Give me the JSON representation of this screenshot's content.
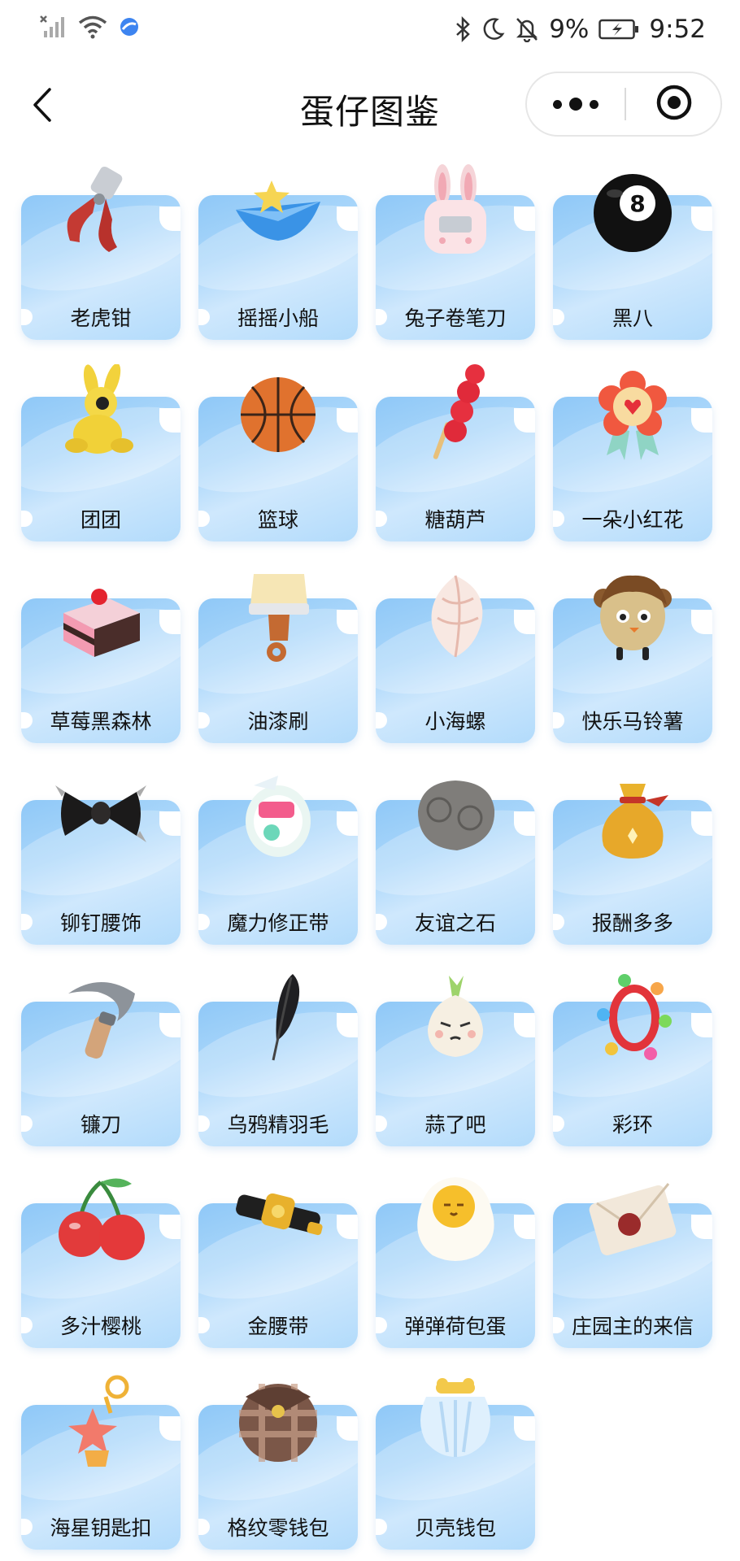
{
  "status_bar": {
    "battery_percent": "9%",
    "time": "9:52",
    "icons": [
      "no-signal-icon",
      "wifi-icon",
      "browser-icon",
      "bluetooth-icon",
      "moon-icon",
      "muted-bell-icon",
      "battery-charging-icon"
    ]
  },
  "nav": {
    "title": "蛋仔图鉴",
    "back_icon": "chevron-left-icon",
    "more_icon": "more-dots-icon",
    "close_icon": "target-close-icon"
  },
  "items": [
    {
      "label": "老虎钳",
      "icon": "pliers-icon"
    },
    {
      "label": "摇摇小船",
      "icon": "paper-boat-icon"
    },
    {
      "label": "兔子卷笔刀",
      "icon": "rabbit-sharpener-icon"
    },
    {
      "label": "黑八",
      "icon": "eight-ball-icon"
    },
    {
      "label": "团团",
      "icon": "yellow-bunny-icon"
    },
    {
      "label": "篮球",
      "icon": "basketball-icon"
    },
    {
      "label": "糖葫芦",
      "icon": "candied-haws-icon"
    },
    {
      "label": "一朵小红花",
      "icon": "red-flower-badge-icon"
    },
    {
      "label": "草莓黑森林",
      "icon": "cake-icon"
    },
    {
      "label": "油漆刷",
      "icon": "paintbrush-icon"
    },
    {
      "label": "小海螺",
      "icon": "seashell-icon"
    },
    {
      "label": "快乐马铃薯",
      "icon": "potato-icon"
    },
    {
      "label": "铆钉腰饰",
      "icon": "bow-icon"
    },
    {
      "label": "魔力修正带",
      "icon": "correction-tape-icon"
    },
    {
      "label": "友谊之石",
      "icon": "stone-icon"
    },
    {
      "label": "报酬多多",
      "icon": "money-bag-icon"
    },
    {
      "label": "镰刀",
      "icon": "sickle-icon"
    },
    {
      "label": "乌鸦精羽毛",
      "icon": "feather-icon"
    },
    {
      "label": "蒜了吧",
      "icon": "garlic-icon"
    },
    {
      "label": "彩环",
      "icon": "color-ring-icon"
    },
    {
      "label": "多汁樱桃",
      "icon": "cherry-icon"
    },
    {
      "label": "金腰带",
      "icon": "gold-belt-icon"
    },
    {
      "label": "弹弹荷包蛋",
      "icon": "fried-egg-icon"
    },
    {
      "label": "庄园主的来信",
      "icon": "letter-icon"
    },
    {
      "label": "海星钥匙扣",
      "icon": "starfish-keychain-icon"
    },
    {
      "label": "格纹零钱包",
      "icon": "plaid-purse-icon"
    },
    {
      "label": "贝壳钱包",
      "icon": "shell-purse-icon"
    }
  ]
}
